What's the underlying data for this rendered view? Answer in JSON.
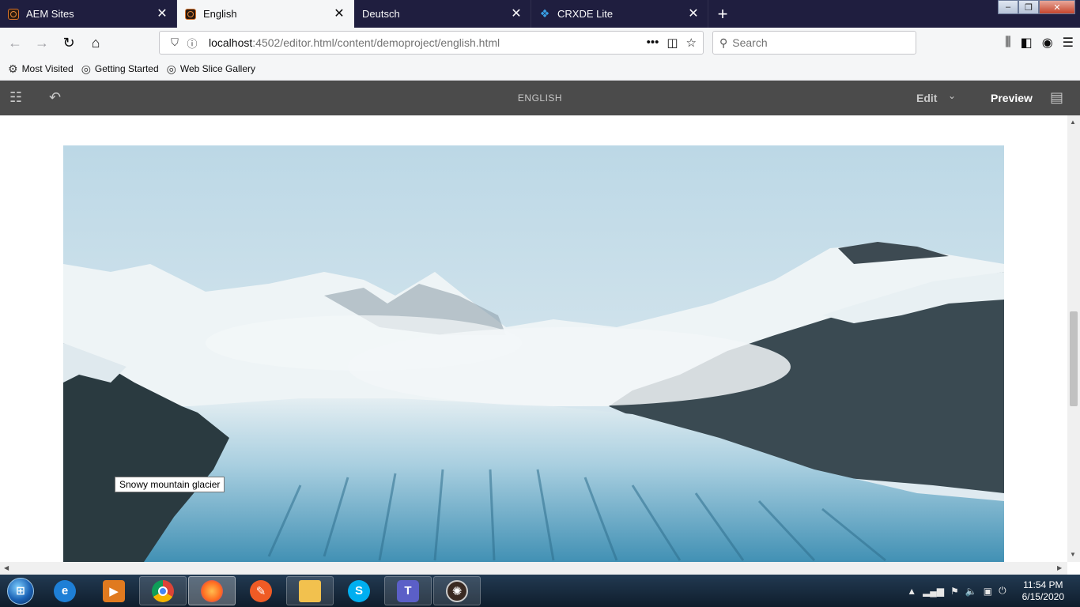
{
  "tabs": [
    {
      "title": "AEM Sites",
      "favicon": "aem-icon",
      "active": false
    },
    {
      "title": "English",
      "favicon": "aem-icon",
      "active": true
    },
    {
      "title": "Deutsch",
      "favicon": "blank-icon",
      "active": false
    },
    {
      "title": "CRXDE Lite",
      "favicon": "crxde-icon",
      "active": false
    }
  ],
  "navbar": {
    "url_host": "localhost",
    "url_rest": ":4502/editor.html/content/demoproject/english.html",
    "search_placeholder": "Search"
  },
  "bookmarks": [
    {
      "label": "Most Visited",
      "icon": "gear-icon"
    },
    {
      "label": "Getting Started",
      "icon": "globe-icon"
    },
    {
      "label": "Web Slice Gallery",
      "icon": "globe-icon"
    }
  ],
  "editor": {
    "page_title": "ENGLISH",
    "mode_label": "Edit",
    "preview_label": "Preview"
  },
  "content": {
    "image_alt_tooltip": "Snowy mountain glacier"
  },
  "taskbar": {
    "time": "11:54 PM",
    "date": "6/15/2020"
  },
  "colors": {
    "tabstrip_bg": "#1f1e3f",
    "aem_toolbar_bg": "#4b4b4b",
    "taskbar_bg": "#1a2d40"
  }
}
